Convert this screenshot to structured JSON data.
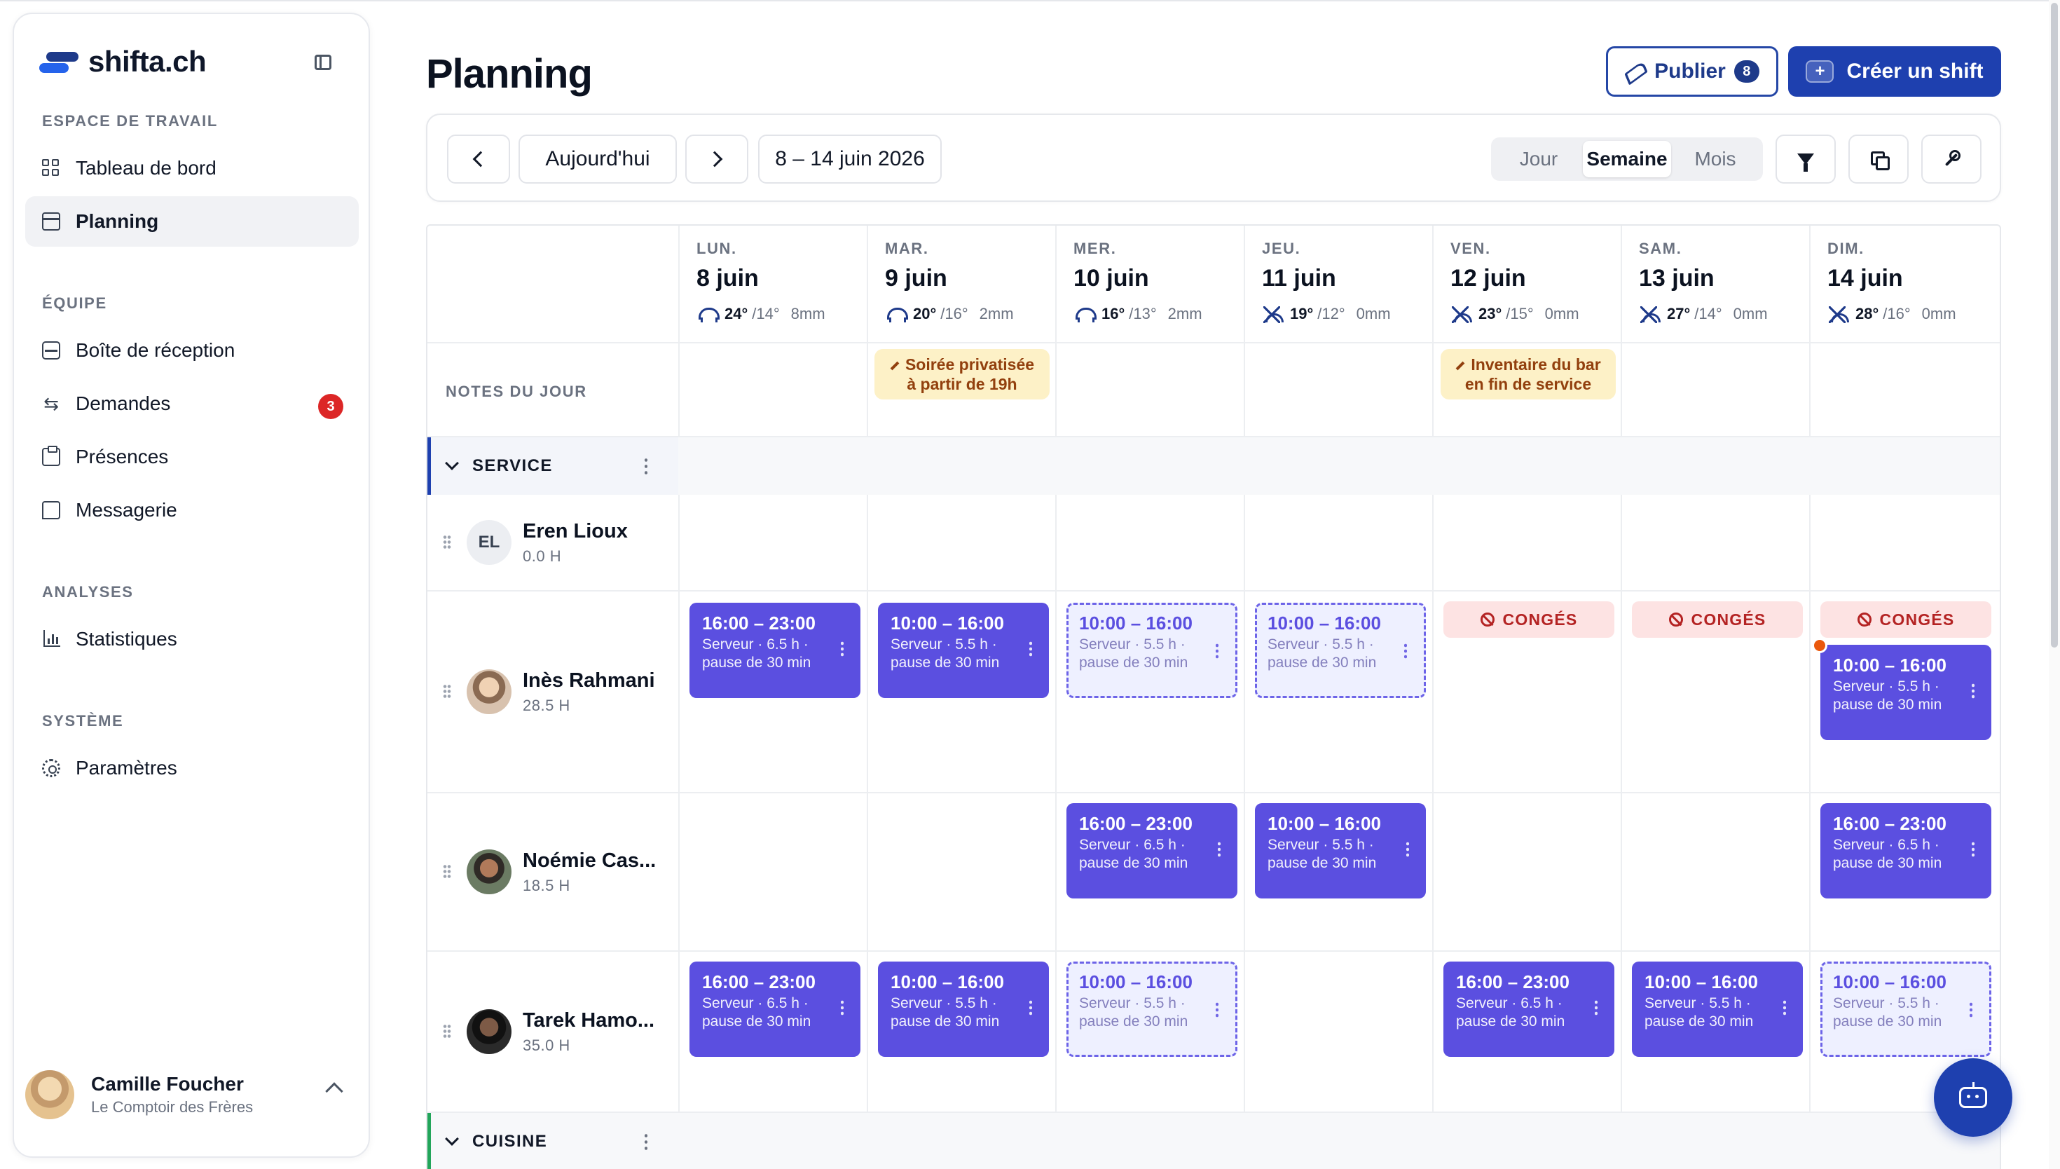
{
  "app": {
    "brand": "shifta.ch"
  },
  "sidebar": {
    "sections": {
      "workspace": "ESPACE DE TRAVAIL",
      "team": "ÉQUIPE",
      "analytics": "ANALYSES",
      "system": "SYSTÈME"
    },
    "items": {
      "dashboard": "Tableau de bord",
      "planning": "Planning",
      "inbox": "Boîte de réception",
      "requests": "Demandes",
      "requests_badge": "3",
      "attendance": "Présences",
      "messaging": "Messagerie",
      "stats": "Statistiques",
      "settings": "Paramètres"
    },
    "user": {
      "name": "Camille Foucher",
      "org": "Le Comptoir des Frères"
    }
  },
  "header": {
    "title": "Planning",
    "publish_label": "Publier",
    "publish_count": "8",
    "create_label": "Créer un shift",
    "create_icon": "+"
  },
  "toolbar": {
    "today": "Aujourd'hui",
    "range": "8 – 14 juin 2026",
    "views": [
      "Jour",
      "Semaine",
      "Mois"
    ],
    "active_view": "Semaine"
  },
  "days": [
    {
      "dow": "LUN.",
      "date": "8 juin",
      "weather_icon": "cloud-rain-icon",
      "high": "24°",
      "low": "/14°",
      "rain": "8mm"
    },
    {
      "dow": "MAR.",
      "date": "9 juin",
      "weather_icon": "cloud-rain-icon",
      "high": "20°",
      "low": "/16°",
      "rain": "2mm"
    },
    {
      "dow": "MER.",
      "date": "10 juin",
      "weather_icon": "cloud-rain-icon",
      "high": "16°",
      "low": "/13°",
      "rain": "2mm"
    },
    {
      "dow": "JEU.",
      "date": "11 juin",
      "weather_icon": "sun-icon",
      "high": "19°",
      "low": "/12°",
      "rain": "0mm"
    },
    {
      "dow": "VEN.",
      "date": "12 juin",
      "weather_icon": "sun-icon",
      "high": "23°",
      "low": "/15°",
      "rain": "0mm"
    },
    {
      "dow": "SAM.",
      "date": "13 juin",
      "weather_icon": "sun-icon",
      "high": "27°",
      "low": "/14°",
      "rain": "0mm"
    },
    {
      "dow": "DIM.",
      "date": "14 juin",
      "weather_icon": "sun-icon",
      "high": "28°",
      "low": "/16°",
      "rain": "0mm"
    }
  ],
  "notes": {
    "label": "NOTES DU JOUR",
    "tue_1": "Soirée privatisée",
    "tue_2": "à partir de 19h",
    "fri_1": "Inventaire du bar",
    "fri_2": "en fin de service"
  },
  "groups": {
    "service": "SERVICE",
    "kitchen": "CUISINE",
    "service_color": "#1e40af",
    "kitchen_color": "#22a55a"
  },
  "employees": [
    {
      "initials": "EL",
      "name": "Eren Lioux",
      "hours": "0.0 H"
    },
    {
      "name": "Inès Rahmani",
      "hours": "28.5 H"
    },
    {
      "name": "Noémie Cas...",
      "hours": "18.5 H"
    },
    {
      "name": "Tarek Hamo...",
      "hours": "35.0 H"
    }
  ],
  "shift_text": {
    "evening": "16:00 – 23:00",
    "day": "10:00 – 16:00",
    "evening_desc": "Serveur · 6.5 h · pause de 30 min",
    "day_desc": "Serveur · 5.5 h · pause de 30 min",
    "leave": "CONGÉS"
  },
  "colors": {
    "shift": "#5b4fe0",
    "primary": "#1e40af",
    "leave_bg": "#fde3e3",
    "note_bg": "#fdf1c7"
  }
}
